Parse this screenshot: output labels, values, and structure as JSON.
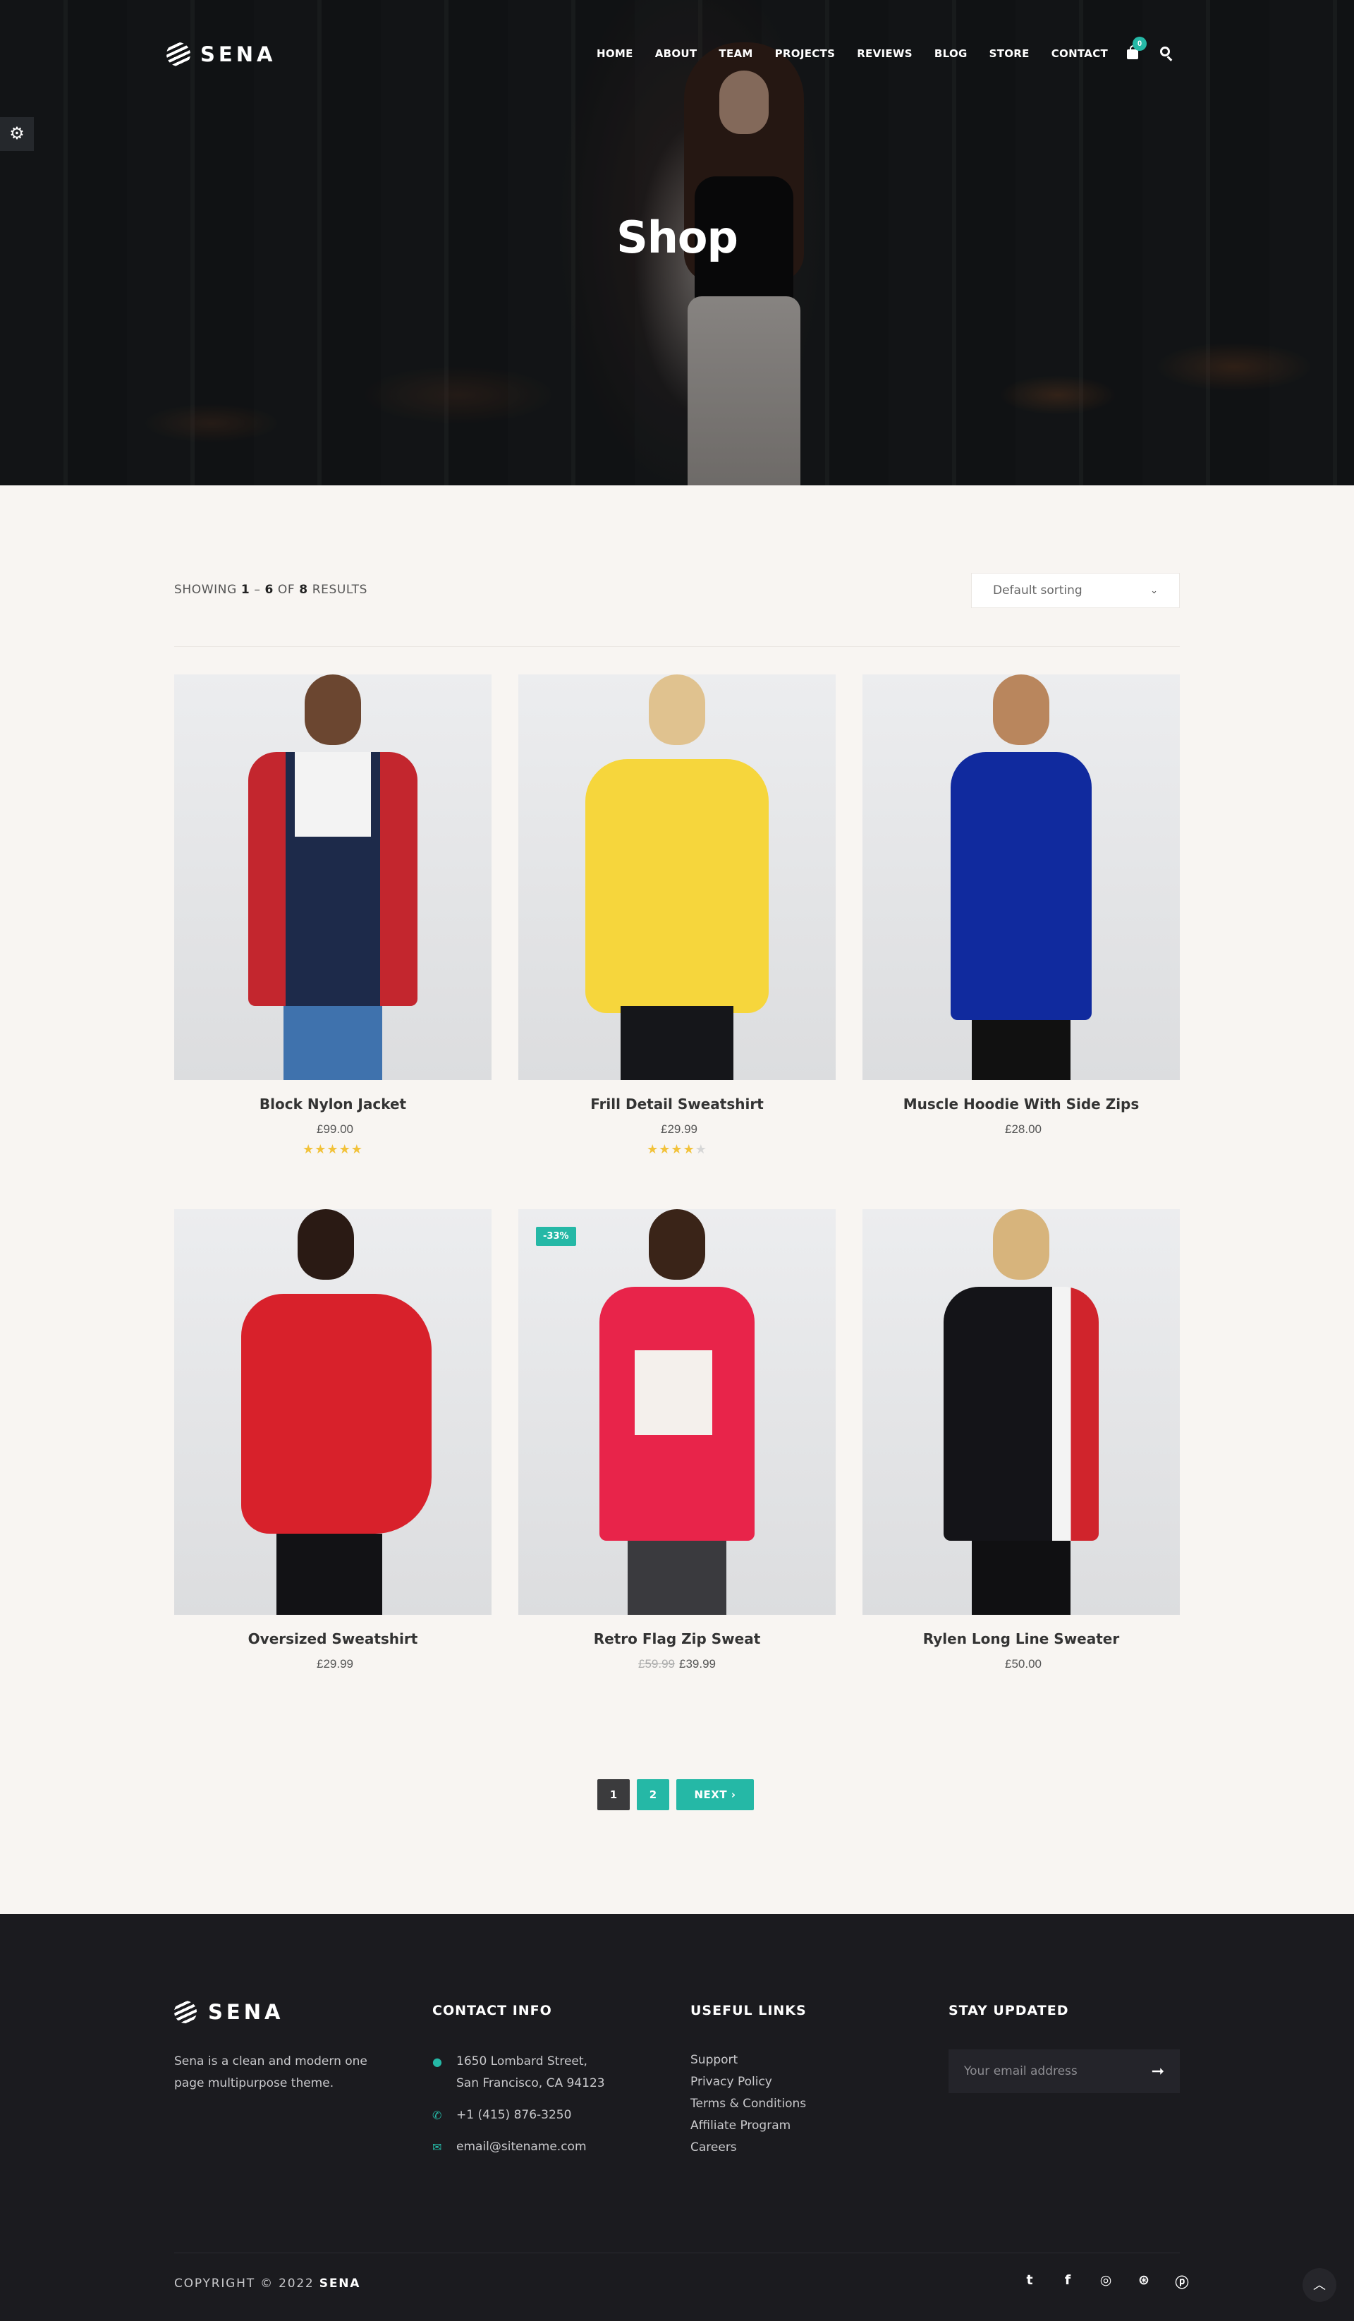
{
  "brand": {
    "name": "SENA"
  },
  "nav": {
    "items": [
      "HOME",
      "ABOUT",
      "TEAM",
      "PROJECTS",
      "REVIEWS",
      "BLOG",
      "STORE",
      "CONTACT"
    ],
    "cart_count": "0"
  },
  "hero": {
    "title": "Shop"
  },
  "toolbar": {
    "showing_prefix": "SHOWING",
    "range_start": "1",
    "range_sep": "–",
    "range_end": "6",
    "of": "OF",
    "total": "8",
    "results": "RESULTS",
    "sort_selected": "Default sorting"
  },
  "products": [
    {
      "name": "Block Nylon Jacket",
      "price": "£99.00",
      "old_price": "",
      "rating": 5,
      "sale": ""
    },
    {
      "name": "Frill Detail Sweatshirt",
      "price": "£29.99",
      "old_price": "",
      "rating": 4,
      "sale": ""
    },
    {
      "name": "Muscle Hoodie With Side Zips",
      "price": "£28.00",
      "old_price": "",
      "rating": 0,
      "sale": ""
    },
    {
      "name": "Oversized Sweatshirt",
      "price": "£29.99",
      "old_price": "",
      "rating": 0,
      "sale": ""
    },
    {
      "name": "Retro Flag Zip Sweat",
      "price": "£39.99",
      "old_price": "£59.99",
      "rating": 0,
      "sale": "-33%"
    },
    {
      "name": "Rylen Long Line Sweater",
      "price": "£50.00",
      "old_price": "",
      "rating": 0,
      "sale": ""
    }
  ],
  "pagination": {
    "page1": "1",
    "page2": "2",
    "next": "NEXT"
  },
  "footer": {
    "brand": "SENA",
    "about": "Sena is a clean and modern one page multipurpose theme.",
    "contact_title": "CONTACT INFO",
    "address_line1": "1650 Lombard Street,",
    "address_line2": "San Francisco, CA 94123",
    "phone": "+1 (415) 876-3250",
    "email": "email@sitename.com",
    "links_title": "USEFUL LINKS",
    "links": [
      "Support",
      "Privacy Policy",
      "Terms & Conditions",
      "Affiliate Program",
      "Careers"
    ],
    "newsletter_title": "STAY UPDATED",
    "newsletter_placeholder": "Your email address",
    "copyright_prefix": "COPYRIGHT © 2022",
    "copyright_brand": "SENA"
  },
  "colors": {
    "accent": "#25b8a6",
    "footer_bg": "#1b1b1f",
    "page_bg": "#f8f5f2",
    "star": "#f2c23a"
  },
  "icons": [
    "settings-gear-icon",
    "cart-icon",
    "search-icon",
    "map-marker-icon",
    "phone-icon",
    "envelope-icon",
    "arrow-right-icon",
    "twitter-icon",
    "facebook-icon",
    "instagram-icon",
    "dribbble-icon",
    "pinterest-icon",
    "chevron-up-icon",
    "chevron-down-icon",
    "chevron-right-icon"
  ]
}
